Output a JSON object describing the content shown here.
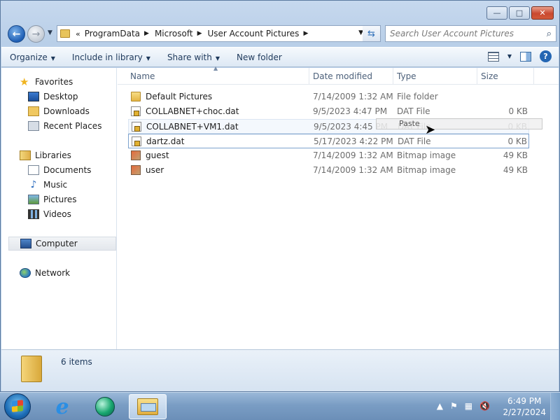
{
  "window": {
    "caption_buttons": {
      "minimize": "—",
      "maximize": "□",
      "close": "✕"
    }
  },
  "address_bar": {
    "overflow": "«",
    "parts": [
      "ProgramData",
      "Microsoft",
      "User Account Pictures"
    ]
  },
  "search": {
    "placeholder": "Search User Account Pictures"
  },
  "command_bar": {
    "organize": "Organize",
    "include_in_library": "Include in library",
    "share_with": "Share with",
    "new_folder": "New folder"
  },
  "nav_pane": {
    "favorites": "Favorites",
    "desktop": "Desktop",
    "downloads": "Downloads",
    "recent_places": "Recent Places",
    "libraries": "Libraries",
    "documents": "Documents",
    "music": "Music",
    "pictures": "Pictures",
    "videos": "Videos",
    "computer": "Computer",
    "network": "Network"
  },
  "columns": {
    "name": "Name",
    "date_modified": "Date modified",
    "type": "Type",
    "size": "Size"
  },
  "files": [
    {
      "name": "Default Pictures",
      "date": "7/14/2009 1:32 AM",
      "type": "File folder",
      "size": "",
      "icon": "folder-icon"
    },
    {
      "name": "COLLABNET+choc.dat",
      "date": "9/5/2023 4:47 PM",
      "type": "DAT File",
      "size": "0 KB",
      "icon": "locked-file-icon"
    },
    {
      "name": "COLLABNET+VM1.dat",
      "date": "9/5/2023 4:45 PM",
      "type": "DAT File",
      "size": "0 KB",
      "icon": "locked-file-icon"
    },
    {
      "name": "dartz.dat",
      "date": "5/17/2023 4:22 PM",
      "type": "DAT File",
      "size": "0 KB",
      "icon": "locked-file-icon"
    },
    {
      "name": "guest",
      "date": "7/14/2009 1:32 AM",
      "type": "Bitmap image",
      "size": "49 KB",
      "icon": "bitmap-icon"
    },
    {
      "name": "user",
      "date": "7/14/2009 1:32 AM",
      "type": "Bitmap image",
      "size": "49 KB",
      "icon": "bitmap-icon"
    }
  ],
  "paste_tooltip": "Paste",
  "details": {
    "item_count": "6 items"
  },
  "taskbar": {
    "time": "6:49 PM",
    "date": "2/27/2024"
  }
}
